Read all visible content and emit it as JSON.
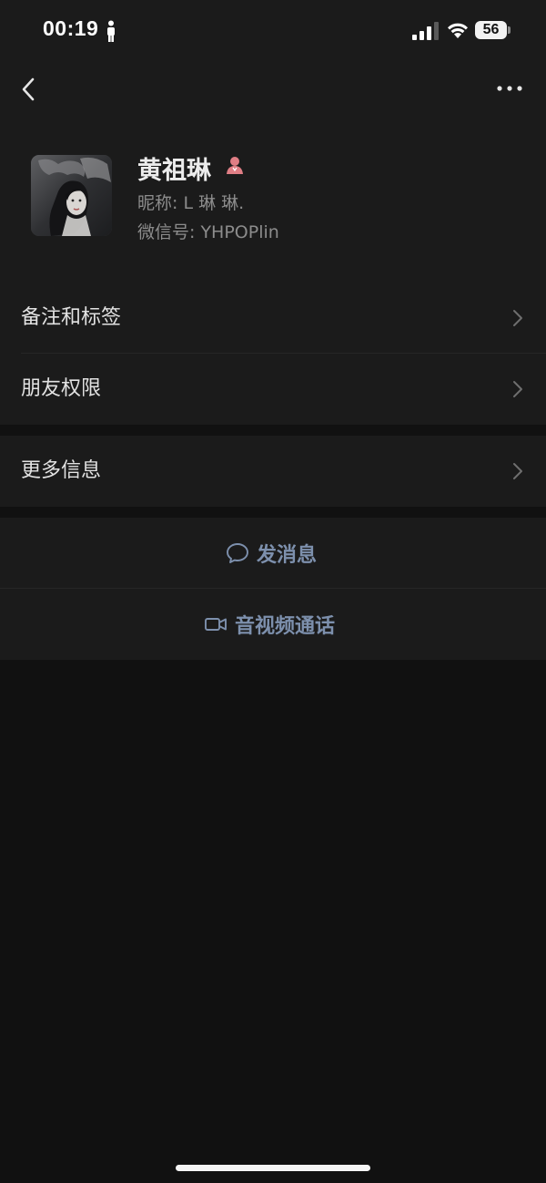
{
  "status_bar": {
    "time": "00:19",
    "battery_level": "56"
  },
  "header": {
    "back_icon": "chevron-left-icon",
    "more_icon": "more-dots-icon"
  },
  "profile": {
    "display_name": "黄祖琳",
    "gender_icon": "female-icon",
    "nickname": "昵称: L 琳 琳.",
    "wechat_id": "微信号: YHPOPlin"
  },
  "cells": [
    {
      "label": "备注和标签"
    },
    {
      "label": "朋友权限"
    },
    {
      "label": "更多信息"
    }
  ],
  "actions": [
    {
      "label": "发消息",
      "icon": "chat-bubble-icon"
    },
    {
      "label": "音视频通话",
      "icon": "video-camera-icon"
    }
  ],
  "colors": {
    "background": "#111111",
    "cell_background": "#1b1b1b",
    "action_text": "#7d90ad",
    "secondary_text": "#8c8c8c",
    "gender_icon": "#e07e85"
  }
}
